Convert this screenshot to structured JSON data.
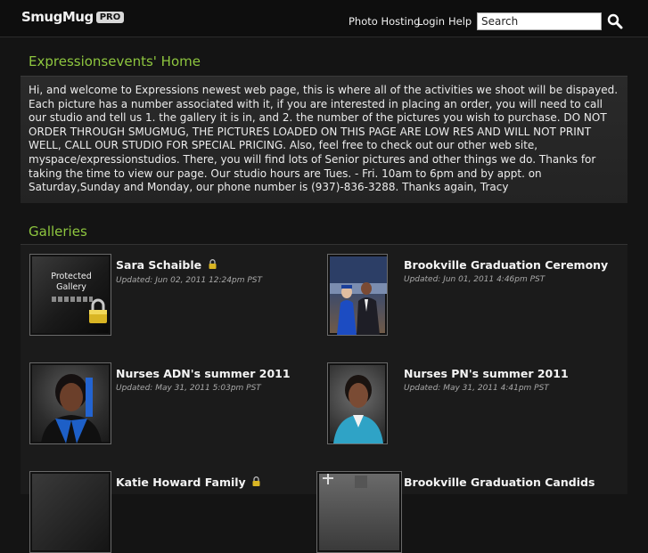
{
  "header": {
    "logo_text": "SmugMug",
    "logo_badge": "PRO",
    "nav": [
      "Photo Hosting",
      "Login",
      "Help"
    ],
    "search_value": "Search"
  },
  "about": {
    "title": "Expressionsevents' Home",
    "text": "Hi, and welcome to Expressions newest web page, this is where all of the activities we shoot will be dispayed. Each picture has a number associated with it, if you are interested in placing an order, you will need to call our studio and tell us 1. the gallery it is in, and 2. the number of the pictures you wish to purchase. DO NOT ORDER THROUGH SMUGMUG, THE PICTURES LOADED ON THIS PAGE ARE LOW RES AND WILL NOT PRINT WELL, CALL OUR STUDIO FOR SPECIAL PRICING. Also, feel free to check out our other web site, myspace/expressionstudios. There, you will find lots of Senior pictures and other things we do. Thanks for taking the time to view our page. Our studio hours are Tues. - Fri. 10am to 6pm and by appt. on Saturday,Sunday and Monday, our phone number is (937)-836-3288. Thanks again, Tracy"
  },
  "galleries": {
    "title": "Galleries",
    "protected_label_1": "Protected",
    "protected_label_2": "Gallery",
    "items": [
      {
        "title": "Sara Schaible",
        "updated": "Updated: Jun 02, 2011 12:24pm PST",
        "locked": true,
        "thumb": "protected"
      },
      {
        "title": "Brookville Graduation Ceremony",
        "updated": "Updated: Jun 01, 2011 4:46pm PST",
        "locked": false,
        "thumb": "graduation"
      },
      {
        "title": "Nurses ADN's summer 2011",
        "updated": "Updated: May 31, 2011 5:03pm PST",
        "locked": false,
        "thumb": "nurse-adn"
      },
      {
        "title": "Nurses PN's summer 2011",
        "updated": "Updated: May 31, 2011 4:41pm PST",
        "locked": false,
        "thumb": "nurse-pn"
      },
      {
        "title": "Katie Howard Family",
        "updated": "",
        "locked": true,
        "thumb": "family"
      },
      {
        "title": "Brookville Graduation Candids",
        "updated": "",
        "locked": false,
        "thumb": "candids"
      }
    ]
  },
  "colors": {
    "accent_green": "#8ec63f",
    "background": "#141414",
    "panel": "#2a2a2a"
  },
  "icons": [
    "search-icon",
    "lock-icon"
  ]
}
